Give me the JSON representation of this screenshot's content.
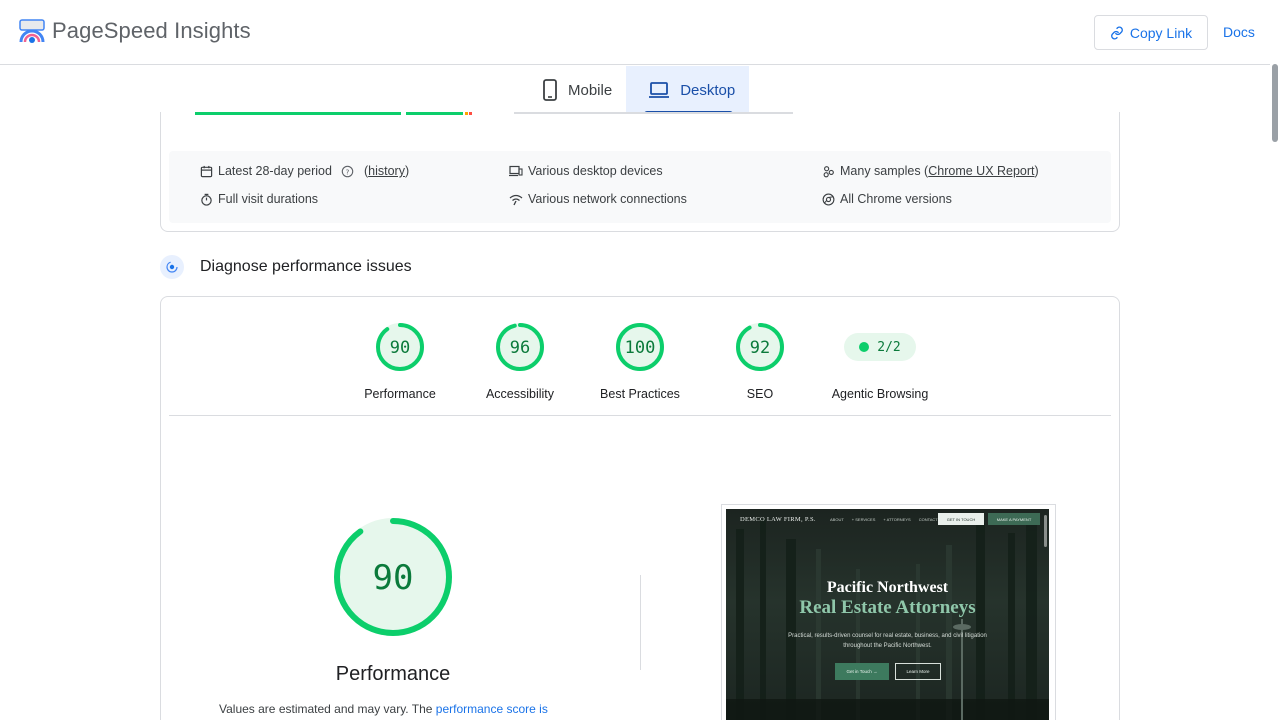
{
  "header": {
    "title": "PageSpeed Insights",
    "copy_link": "Copy Link",
    "docs": "Docs"
  },
  "tabs": [
    {
      "label": "Mobile",
      "icon": "phone-icon",
      "active": false
    },
    {
      "label": "Desktop",
      "icon": "laptop-icon",
      "active": true
    }
  ],
  "field_info": {
    "period": "Latest 28-day period",
    "history": "history",
    "devices": "Various desktop devices",
    "samples_prefix": "Many samples (",
    "samples_link": "Chrome UX Report",
    "samples_suffix": ")",
    "durations": "Full visit durations",
    "network": "Various network connections",
    "chrome": "All Chrome versions"
  },
  "diagnose": {
    "title": "Diagnose performance issues"
  },
  "scores": [
    {
      "label": "Performance",
      "value": 90
    },
    {
      "label": "Accessibility",
      "value": 96
    },
    {
      "label": "Best Practices",
      "value": 100
    },
    {
      "label": "SEO",
      "value": 92
    }
  ],
  "agentic": {
    "label": "Agentic Browsing",
    "value": "2/2"
  },
  "performance_detail": {
    "score": "90",
    "score_value": 90,
    "title": "Performance",
    "note_prefix": "Values are estimated and may vary. The ",
    "note_link": "performance score is"
  },
  "preview": {
    "brand": "DEMCO LAW FIRM, P.S.",
    "nav": [
      "ABOUT",
      "+ SERVICES",
      "+ ATTORNEYS",
      "CONTACT"
    ],
    "nav_btn1": "GET IN TOUCH",
    "nav_btn2": "MAKE A PAYMENT",
    "hero_line1": "Pacific Northwest",
    "hero_line2": "Real Estate Attorneys",
    "hero_sub": "Practical, results-driven counsel for real estate, business, and civil litigation throughout the Pacific Northwest.",
    "btn_primary": "Get in Touch →",
    "btn_secondary": "Learn More"
  },
  "colors": {
    "good": "#0cce6b",
    "good_text": "#0b7a3b",
    "link": "#1a73e8",
    "tab_active": "#1a4fa8"
  }
}
